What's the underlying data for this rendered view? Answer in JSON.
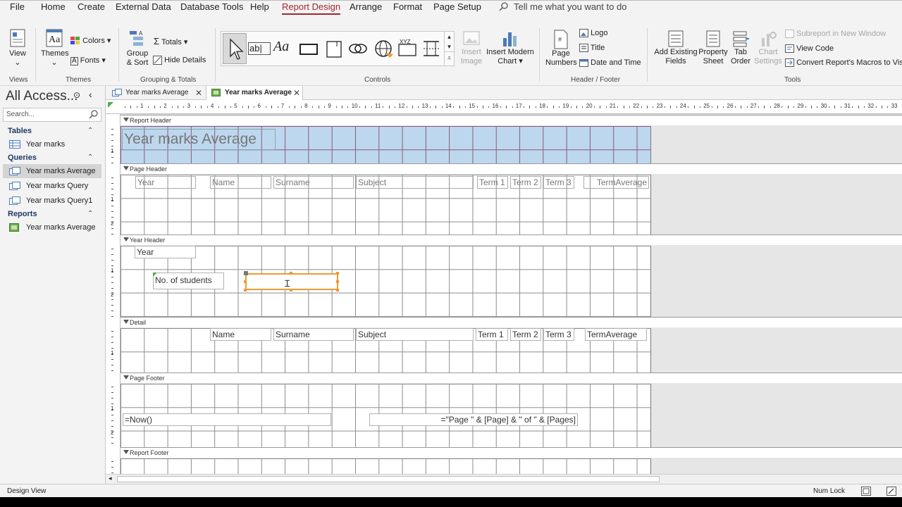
{
  "menu": {
    "tabs": [
      "File",
      "Home",
      "Create",
      "External Data",
      "Database Tools",
      "Help",
      "Report Design",
      "Arrange",
      "Format",
      "Page Setup"
    ],
    "active": "Report Design",
    "tell_me": "Tell me what you want to do"
  },
  "ribbon": {
    "view": "View",
    "themes": "Themes",
    "colors": "Colors",
    "fonts": "Fonts",
    "group_sort_1": "Group",
    "group_sort_2": "& Sort",
    "totals": "Totals",
    "hide_details": "Hide Details",
    "insert_image_1": "Insert",
    "insert_image_2": "Image",
    "insert_chart_1": "Insert Modern",
    "insert_chart_2": "Chart",
    "page_numbers_1": "Page",
    "page_numbers_2": "Numbers",
    "logo": "Logo",
    "title": "Title",
    "date_time": "Date and Time",
    "add_fields_1": "Add Existing",
    "add_fields_2": "Fields",
    "property_sheet_1": "Property",
    "property_sheet_2": "Sheet",
    "tab_order_1": "Tab",
    "tab_order_2": "Order",
    "chart_settings_1": "Chart",
    "chart_settings_2": "Settings",
    "subreport": "Subreport in New Window",
    "view_code": "View Code",
    "convert_macros": "Convert Report's Macros to Visual Basic",
    "groups": {
      "views": "Views",
      "themes": "Themes",
      "grouping": "Grouping & Totals",
      "controls": "Controls",
      "header_footer": "Header / Footer",
      "tools": "Tools"
    },
    "text_box_glyph": "ab|",
    "label_glyph": "Aa",
    "xyz_glyph": "XYZ"
  },
  "nav": {
    "title": "All Access...",
    "search_placeholder": "Search...",
    "sections": {
      "tables": "Tables",
      "queries": "Queries",
      "reports": "Reports"
    },
    "tables": [
      "Year marks"
    ],
    "queries": [
      "Year marks Average",
      "Year marks Query",
      "Year marks Query1"
    ],
    "reports": [
      "Year marks Average"
    ]
  },
  "doc_tabs": [
    "Year marks Average",
    "Year marks Average"
  ],
  "ruler_numbers": [
    "1",
    "2",
    "3",
    "4",
    "5",
    "6",
    "7",
    "8",
    "9",
    "10",
    "11",
    "12",
    "13",
    "14",
    "15",
    "16",
    "17",
    "18",
    "19",
    "20",
    "21",
    "22",
    "23",
    "24",
    "25",
    "26",
    "27",
    "28",
    "29",
    "30",
    "31",
    "32",
    "33"
  ],
  "ruler_v_marks": [
    "1",
    "2"
  ],
  "bands": {
    "report_header": "Report Header",
    "page_header": "Page Header",
    "year_header": "Year Header",
    "detail": "Detail",
    "page_footer": "Page Footer",
    "report_footer": "Report Footer"
  },
  "report_title": "Year marks Average",
  "page_header_labels": [
    "Year",
    "Name",
    "Surname",
    "Subject",
    "Term 1",
    "Term 2",
    "Term 3",
    "TermAverage"
  ],
  "year_header": {
    "year": "Year",
    "students_label": "No. of students"
  },
  "detail_fields": [
    "Name",
    "Surname",
    "Subject",
    "Term 1",
    "Term 2",
    "Term 3",
    "TermAverage"
  ],
  "page_footer": {
    "now": "=Now()",
    "page": "=\"Page \" & [Page] & \" of \" & [Pages]"
  },
  "status": {
    "mode": "Design View",
    "num_lock": "Num Lock"
  }
}
